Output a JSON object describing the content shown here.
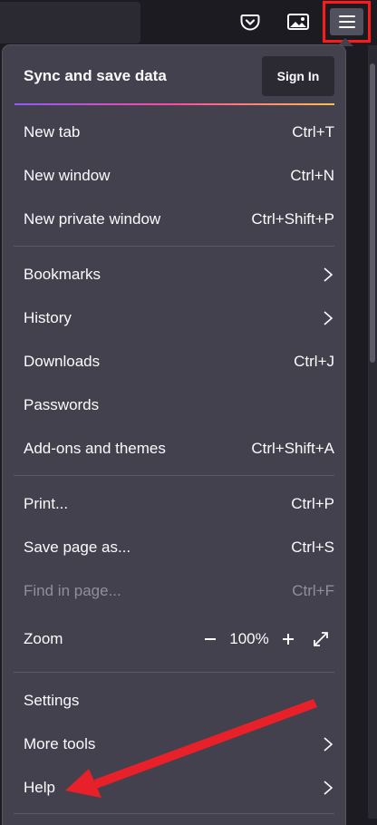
{
  "toolbar": {
    "pocket_icon": "pocket-icon",
    "screenshot_icon": "screenshot-icon",
    "menu_icon": "hamburger-menu-icon"
  },
  "menu": {
    "sync_title": "Sync and save data",
    "sign_in_label": "Sign In",
    "items": [
      {
        "label": "New tab",
        "shortcut": "Ctrl+T"
      },
      {
        "label": "New window",
        "shortcut": "Ctrl+N"
      },
      {
        "label": "New private window",
        "shortcut": "Ctrl+Shift+P"
      },
      {
        "label": "Bookmarks",
        "shortcut": ""
      },
      {
        "label": "History",
        "shortcut": ""
      },
      {
        "label": "Downloads",
        "shortcut": "Ctrl+J"
      },
      {
        "label": "Passwords",
        "shortcut": ""
      },
      {
        "label": "Add-ons and themes",
        "shortcut": "Ctrl+Shift+A"
      },
      {
        "label": "Print...",
        "shortcut": "Ctrl+P"
      },
      {
        "label": "Save page as...",
        "shortcut": "Ctrl+S"
      },
      {
        "label": "Find in page...",
        "shortcut": "Ctrl+F"
      },
      {
        "label": "Settings",
        "shortcut": ""
      },
      {
        "label": "More tools",
        "shortcut": ""
      },
      {
        "label": "Help",
        "shortcut": ""
      }
    ],
    "zoom": {
      "label": "Zoom",
      "value": "100%"
    }
  },
  "colors": {
    "panel_bg": "#42414d",
    "highlight": "#ff1a1a",
    "annotation_arrow": "#e8202a"
  }
}
